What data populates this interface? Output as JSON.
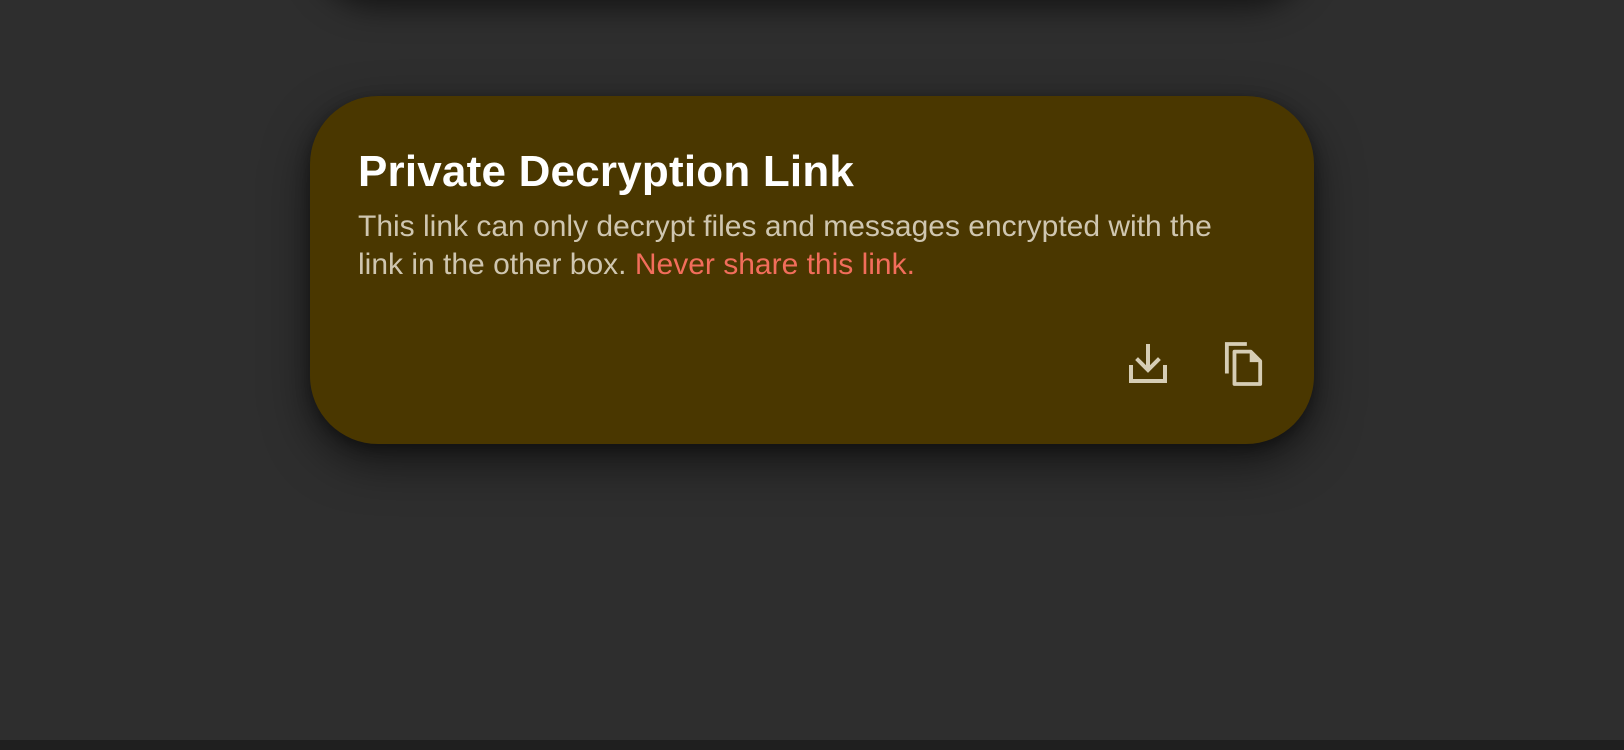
{
  "card": {
    "title": "Private Decryption Link",
    "description": "This link can only decrypt files and messages encrypted with the link in the other box.",
    "warning": "Never share this link.",
    "background_color": "#4a3700",
    "warning_color": "#f26d5b",
    "actions": [
      {
        "icon": "download-icon"
      },
      {
        "icon": "copy-icon"
      }
    ]
  },
  "page": {
    "background_color": "#2e2e2e"
  }
}
